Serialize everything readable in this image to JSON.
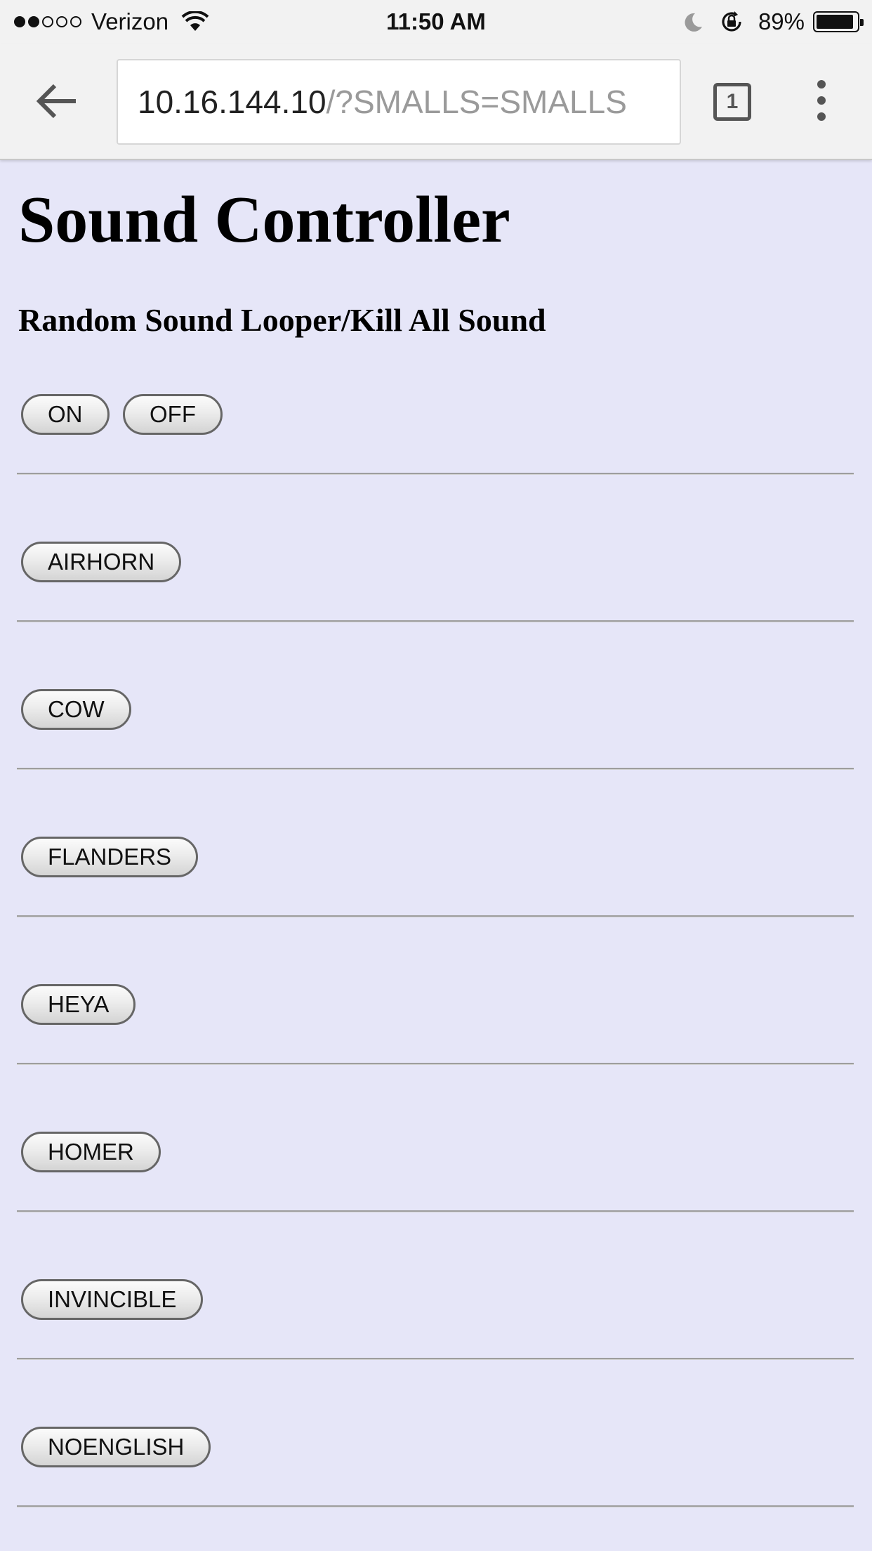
{
  "status_bar": {
    "carrier": "Verizon",
    "time": "11:50 AM",
    "battery": "89%"
  },
  "browser": {
    "url_host": "10.16.144.10",
    "url_rest": "/?SMALLS=SMALLS",
    "tab_count": "1"
  },
  "page": {
    "title": "Sound Controller",
    "subtitle": "Random Sound Looper/Kill All Sound",
    "looper_buttons": [
      "ON",
      "OFF"
    ],
    "sound_buttons": [
      "AIRHORN",
      "COW",
      "FLANDERS",
      "HEYA",
      "HOMER",
      "INVINCIBLE",
      "NOENGLISH"
    ]
  },
  "colors": {
    "page_background": "#e6e6f8",
    "browser_chrome": "#f2f2f2"
  }
}
